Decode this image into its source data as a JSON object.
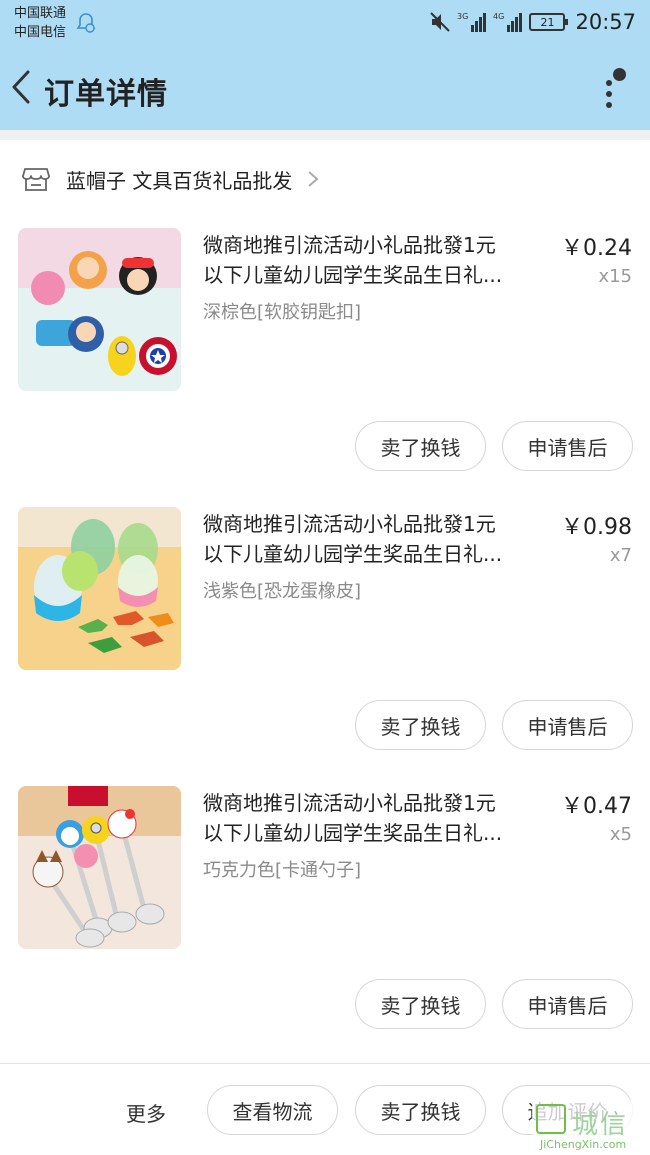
{
  "status_bar": {
    "carrier_1": "中国联通",
    "carrier_2": "中国电信",
    "net_1": "3G",
    "net_2": "4G",
    "battery": "21",
    "time": "20:57"
  },
  "header": {
    "title": "订单详情",
    "background": "#aedcf5"
  },
  "shop": {
    "name": "蓝帽子 文具百货礼品批发"
  },
  "items": [
    {
      "title_line1": "微商地推引流活动小礼品批發1元",
      "title_line2": "以下儿童幼儿园学生奖品生日礼...",
      "spec": "深棕色[软胶钥匙扣]",
      "price": "￥0.24",
      "qty": "x15",
      "sell_label": "卖了换钱",
      "aftersale_label": "申请售后"
    },
    {
      "title_line1": "微商地推引流活动小礼品批發1元",
      "title_line2": "以下儿童幼儿园学生奖品生日礼...",
      "spec": "浅紫色[恐龙蛋橡皮]",
      "price": "￥0.98",
      "qty": "x7",
      "sell_label": "卖了换钱",
      "aftersale_label": "申请售后"
    },
    {
      "title_line1": "微商地推引流活动小礼品批發1元",
      "title_line2": "以下儿童幼儿园学生奖品生日礼...",
      "spec": "巧克力色[卡通勺子]",
      "price": "￥0.47",
      "qty": "x5",
      "sell_label": "卖了换钱",
      "aftersale_label": "申请售后"
    }
  ],
  "bottom_bar": {
    "more": "更多",
    "logistics": "查看物流",
    "sell": "卖了换钱",
    "review": "追加评价"
  },
  "watermark": {
    "cn": "城信",
    "en": "JiChengXin.com"
  }
}
